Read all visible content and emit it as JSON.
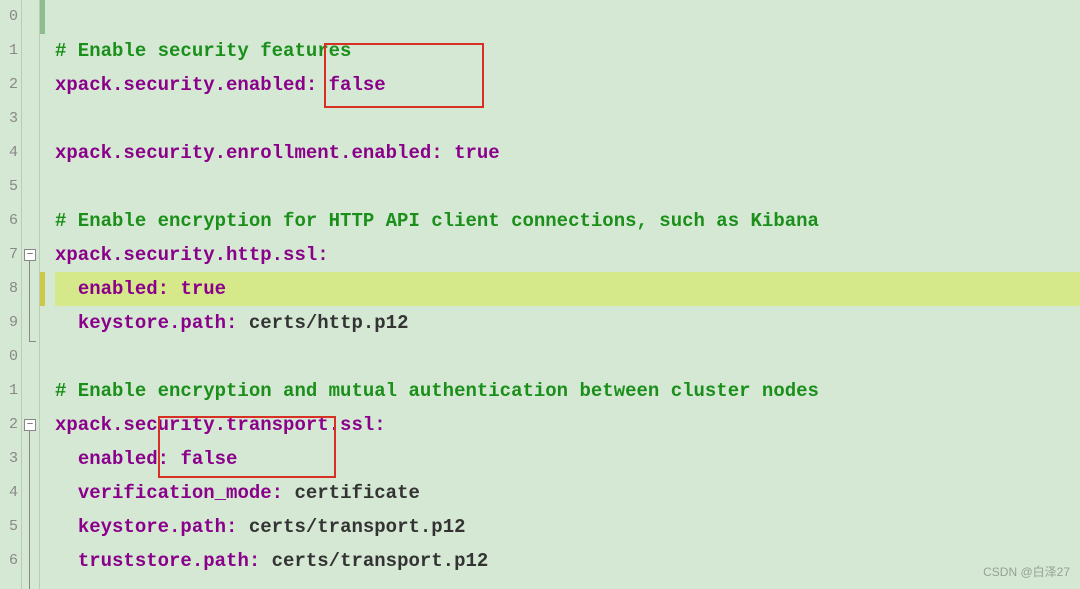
{
  "gutter_digits": [
    "0",
    "1",
    "2",
    "3",
    "4",
    "5",
    "6",
    "7",
    "8",
    "9",
    "0",
    "1",
    "2",
    "3",
    "4",
    "5",
    "6"
  ],
  "lines": {
    "comment_security": "# Enable security features",
    "sec_enabled_key": "xpack.security.enabled",
    "sec_enabled_val": "false",
    "blank": " ",
    "enroll_key": "xpack.security.enrollment.enabled",
    "enroll_val": "true",
    "comment_http": "# Enable encryption for HTTP API client connections, such as Kibana",
    "http_ssl_key": "xpack.security.http.ssl",
    "enabled_key": "enabled",
    "http_enabled_val": "true",
    "keystore_key": "keystore.path",
    "http_keystore_val": "certs/http.p12",
    "comment_transport": "# Enable encryption and mutual authentication between cluster nodes",
    "transport_ssl_key": "xpack.security.transport.ssl",
    "transport_enabled_val": "false",
    "verif_key": "verification_mode",
    "verif_val": "certificate",
    "transport_keystore_val": "certs/transport.p12",
    "truststore_key": "truststore.path",
    "truststore_val": "certs/transport.p12"
  },
  "colon": ":",
  "watermark": "CSDN @白泽27"
}
